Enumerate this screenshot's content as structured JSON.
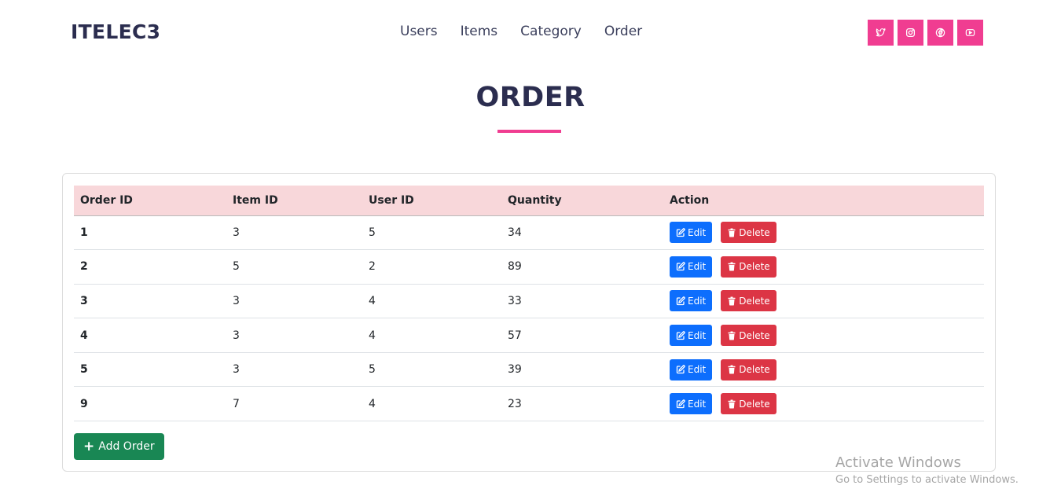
{
  "brand": "ITELEC3",
  "nav": [
    "Users",
    "Items",
    "Category",
    "Order"
  ],
  "social": [
    "twitter-icon",
    "instagram-icon",
    "facebook-icon",
    "youtube-icon"
  ],
  "page_title": "ORDER",
  "colors": {
    "accent": "#f03d91",
    "header_bg": "#f8d7da",
    "edit": "#0d6efd",
    "delete": "#dc3545",
    "add": "#198754",
    "title": "#2b2d4f"
  },
  "table": {
    "headers": [
      "Order ID",
      "Item ID",
      "User ID",
      "Quantity",
      "Action"
    ],
    "rows": [
      [
        "1",
        "3",
        "5",
        "34"
      ],
      [
        "2",
        "5",
        "2",
        "89"
      ],
      [
        "3",
        "3",
        "4",
        "33"
      ],
      [
        "4",
        "3",
        "4",
        "57"
      ],
      [
        "5",
        "3",
        "5",
        "39"
      ],
      [
        "9",
        "7",
        "4",
        "23"
      ]
    ],
    "edit_label": "Edit",
    "delete_label": "Delete"
  },
  "add_button": "Add Order",
  "watermark": {
    "line1": "Activate Windows",
    "line2": "Go to Settings to activate Windows."
  }
}
